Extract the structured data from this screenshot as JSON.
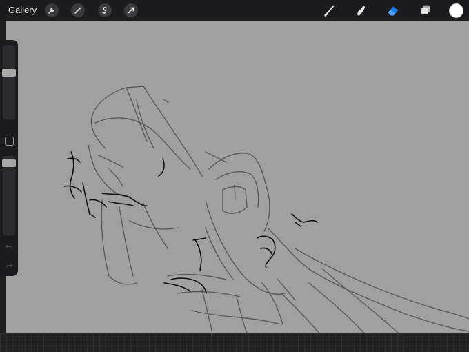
{
  "topbar": {
    "gallery_label": "Gallery",
    "left_tools": [
      "wrench-icon",
      "magic-wand-icon",
      "selection-icon",
      "transform-arrow-icon"
    ],
    "right_tools": [
      "brush-icon",
      "smudge-icon",
      "eraser-icon",
      "layers-icon"
    ],
    "active_tool": "eraser-icon",
    "active_color": "#ffffff",
    "accent_color": "#1e7cf2"
  },
  "sidebar": {
    "brush_size": 0.36,
    "opacity": 0.05
  }
}
